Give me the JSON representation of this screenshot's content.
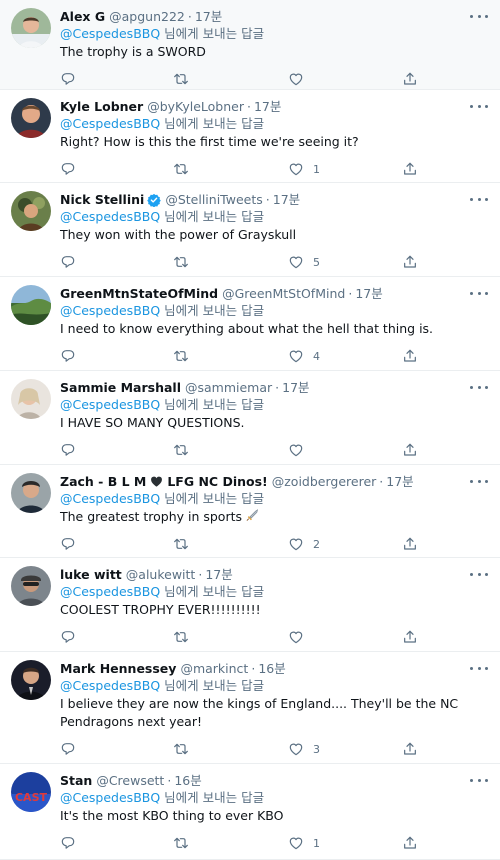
{
  "reply_to_prefix": "",
  "reply_mention": "@CespedesBBQ",
  "reply_suffix": " 님에게 보내는 답글",
  "tweets": [
    {
      "name": "Alex G",
      "handle": "@apgun222",
      "time": "17분",
      "text": "The trophy is a SWORD",
      "likes": ""
    },
    {
      "name": "Kyle Lobner",
      "handle": "@byKyleLobner",
      "time": "17분",
      "text": "Right? How is this the first time we're seeing it?",
      "likes": "1"
    },
    {
      "name": "Nick Stellini",
      "handle": "@StelliniTweets",
      "time": "17분",
      "text": "They won with the power of Grayskull",
      "likes": "5"
    },
    {
      "name": "GreenMtnStateOfMind",
      "handle": "@GreenMtStOfMind",
      "time": "17분",
      "text": "I need to know everything about what the hell that thing is.",
      "likes": "4"
    },
    {
      "name": "Sammie Marshall",
      "handle": "@sammiemar",
      "time": "17분",
      "text": "I HAVE SO MANY QUESTIONS.",
      "likes": ""
    },
    {
      "name_a": "Zach - B L M",
      "name_b": "LFG NC Dinos!",
      "handle": "@zoidbergererer",
      "time": "17분",
      "text": "The greatest trophy in sports",
      "likes": "2"
    },
    {
      "name": "luke witt",
      "handle": "@alukewitt",
      "time": "17분",
      "text": "COOLEST TROPHY EVER!!!!!!!!!!",
      "likes": ""
    },
    {
      "name": "Mark Hennessey",
      "handle": "@markinct",
      "time": "16분",
      "text": "I believe they are now the kings of England....  They'll be the NC Pendragons next year!",
      "likes": "3"
    },
    {
      "name": "Stan",
      "handle": "@Crewsett",
      "time": "16분",
      "text": "It's the most KBO thing to ever KBO",
      "likes": "1"
    }
  ]
}
